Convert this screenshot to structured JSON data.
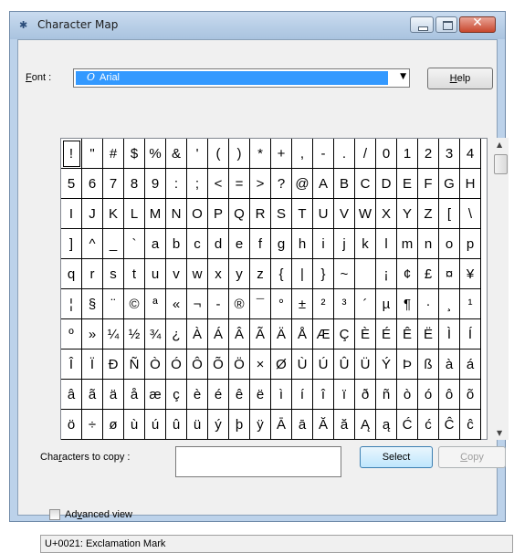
{
  "window": {
    "title": "Character Map",
    "app_icon": "character-map-icon",
    "controls": [
      "minimize-icon",
      "maximize-icon",
      "close-icon"
    ]
  },
  "font": {
    "label_prefix": "F",
    "label_rest": "ont :",
    "selected": "Arial",
    "icon_glyph": "O",
    "dropdown_arrow": "▼"
  },
  "help_button": {
    "label_prefix": "H",
    "label_rest": "elp"
  },
  "characters": [
    "!",
    "\"",
    "#",
    "$",
    "%",
    "&",
    "'",
    "(",
    ")",
    "*",
    "+",
    ",",
    "-",
    ".",
    "/",
    "0",
    "1",
    "2",
    "3",
    "4",
    "5",
    "6",
    "7",
    "8",
    "9",
    ":",
    ";",
    "<",
    "=",
    ">",
    "?",
    "@",
    "A",
    "B",
    "C",
    "D",
    "E",
    "F",
    "G",
    "H",
    "I",
    "J",
    "K",
    "L",
    "M",
    "N",
    "O",
    "P",
    "Q",
    "R",
    "S",
    "T",
    "U",
    "V",
    "W",
    "X",
    "Y",
    "Z",
    "[",
    "\\",
    "]",
    "^",
    "_",
    "`",
    "a",
    "b",
    "c",
    "d",
    "e",
    "f",
    "g",
    "h",
    "i",
    "j",
    "k",
    "l",
    "m",
    "n",
    "o",
    "p",
    "q",
    "r",
    "s",
    "t",
    "u",
    "v",
    "w",
    "x",
    "y",
    "z",
    "{",
    "|",
    "}",
    "~",
    " ",
    "¡",
    "¢",
    "£",
    "¤",
    "¥",
    "¦",
    "§",
    "¨",
    "©",
    "ª",
    "«",
    "¬",
    "-",
    "®",
    "¯",
    "°",
    "±",
    "²",
    "³",
    "´",
    "µ",
    "¶",
    "·",
    "¸",
    "¹",
    "º",
    "»",
    "¼",
    "½",
    "¾",
    "¿",
    "À",
    "Á",
    "Â",
    "Ã",
    "Ä",
    "Å",
    "Æ",
    "Ç",
    "È",
    "É",
    "Ê",
    "Ë",
    "Ì",
    "Í",
    "Î",
    "Ï",
    "Ð",
    "Ñ",
    "Ò",
    "Ó",
    "Ô",
    "Õ",
    "Ö",
    "×",
    "Ø",
    "Ù",
    "Ú",
    "Û",
    "Ü",
    "Ý",
    "Þ",
    "ß",
    "à",
    "á",
    "â",
    "ã",
    "ä",
    "å",
    "æ",
    "ç",
    "è",
    "é",
    "ê",
    "ë",
    "ì",
    "í",
    "î",
    "ï",
    "ð",
    "ñ",
    "ò",
    "ó",
    "ô",
    "õ",
    "ö",
    "÷",
    "ø",
    "ù",
    "ú",
    "û",
    "ü",
    "ý",
    "þ",
    "ÿ",
    "Ā",
    "ā",
    "Ă",
    "ă",
    "Ą",
    "ą",
    "Ć",
    "ć",
    "Ĉ",
    "ĉ"
  ],
  "selected_character_index": 0,
  "copy": {
    "label_before": "Cha",
    "label_u": "r",
    "label_after": "acters to copy :",
    "value": "",
    "select_label": "Select",
    "copy_label_prefix": "C",
    "copy_label_rest": "opy"
  },
  "advanced": {
    "label_before": "Ad",
    "label_u": "v",
    "label_after": "anced view",
    "checked": false
  },
  "status": "U+0021: Exclamation Mark",
  "colors": {
    "selection": "#3399ff",
    "titlebar": "#b9cfe8",
    "close": "#c8472d"
  }
}
